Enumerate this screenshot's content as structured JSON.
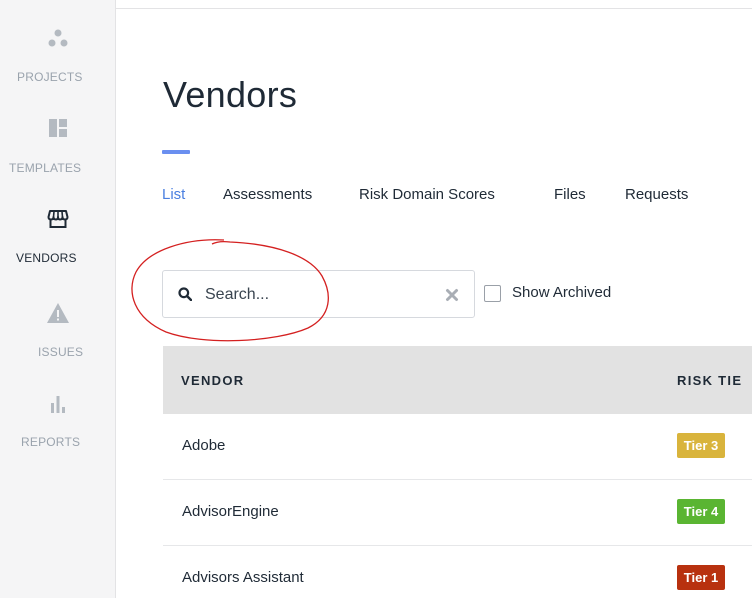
{
  "sidebar": {
    "items": [
      {
        "label": "PROJECTS",
        "icon": "projects-dots-icon",
        "active": false
      },
      {
        "label": "TEMPLATES",
        "icon": "templates-layout-icon",
        "active": false
      },
      {
        "label": "VENDORS",
        "icon": "storefront-icon",
        "active": true
      },
      {
        "label": "ISSUES",
        "icon": "warning-triangle-icon",
        "active": false
      },
      {
        "label": "REPORTS",
        "icon": "bar-chart-icon",
        "active": false
      }
    ]
  },
  "page": {
    "title": "Vendors",
    "accent_color": "#6a8ff0"
  },
  "tabs": [
    {
      "label": "List",
      "active": true
    },
    {
      "label": "Assessments",
      "active": false
    },
    {
      "label": "Risk Domain Scores",
      "active": false
    },
    {
      "label": "Files",
      "active": false
    },
    {
      "label": "Requests",
      "active": false
    }
  ],
  "search": {
    "placeholder": "Search...",
    "value": ""
  },
  "filters": {
    "show_archived_label": "Show Archived",
    "show_archived_checked": false
  },
  "table": {
    "columns": [
      "VENDOR",
      "RISK TIE"
    ],
    "rows": [
      {
        "vendor": "Adobe",
        "tier": "Tier 3",
        "tier_color": "#d9b43c"
      },
      {
        "vendor": "AdvisorEngine",
        "tier": "Tier 4",
        "tier_color": "#5ab532"
      },
      {
        "vendor": "Advisors Assistant",
        "tier": "Tier 1",
        "tier_color": "#b8310f"
      }
    ]
  },
  "annotation": {
    "color": "#d42020",
    "shape": "hand-drawn-circle"
  }
}
